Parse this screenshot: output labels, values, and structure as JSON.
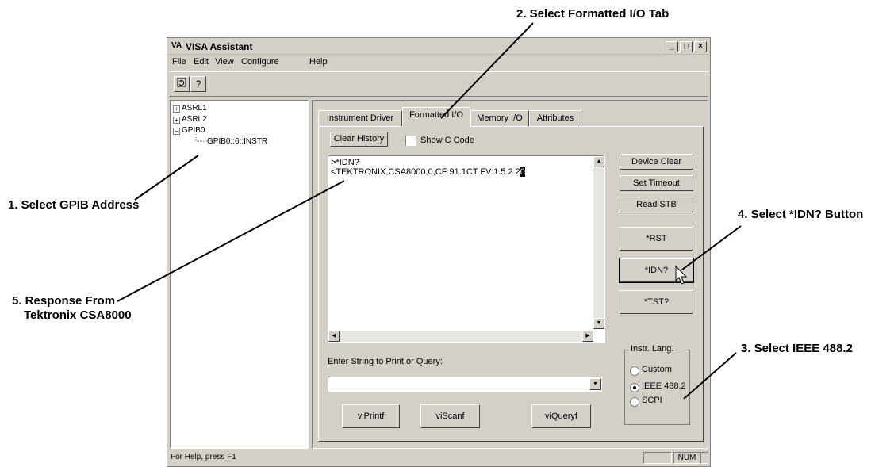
{
  "callouts": {
    "c1": "1. Select GPIB Address",
    "c2": "2. Select Formatted I/O Tab",
    "c3": "3. Select IEEE 488.2",
    "c4": "4. Select *IDN? Button",
    "c5_line1": "5. Response From",
    "c5_line2": "Tektronix CSA8000"
  },
  "window": {
    "title": "VISA Assistant",
    "icon_text": "VA",
    "minimize": "_",
    "maximize": "□",
    "close": "×"
  },
  "menu": [
    "File",
    "Edit",
    "View",
    "Configure",
    "Help"
  ],
  "toolbar": {
    "refresh_icon": "refresh-icon",
    "help_icon": "help-icon"
  },
  "tree": {
    "nodes": [
      {
        "label": "ASRL1",
        "expander": "+"
      },
      {
        "label": "ASRL2",
        "expander": "+"
      },
      {
        "label": "GPIB0",
        "expander": "−"
      },
      {
        "label": "GPIB0::6::INSTR",
        "expander": ""
      }
    ]
  },
  "tabs": [
    "Instrument Driver",
    "Formatted I/O",
    "Memory I/O",
    "Attributes"
  ],
  "formatted_io": {
    "clear_history": "Clear History",
    "show_c_code": "Show C Code",
    "output_lines": [
      ">*IDN?",
      "<TEKTRONIX,CSA8000,0,CF:91.1CT FV:1.5.2.2"
    ],
    "output_selected_char": "0",
    "side_buttons": [
      "Device Clear",
      "Set Timeout",
      "Read STB",
      "*RST",
      "*IDN?",
      "*TST?"
    ],
    "input_label": "Enter String to Print or Query:",
    "input_value": "",
    "action_buttons": [
      "viPrintf",
      "viScanf",
      "viQueryf"
    ],
    "lang_group": "Instr. Lang.",
    "lang_options": [
      "Custom",
      "IEEE 488.2",
      "SCPI"
    ],
    "lang_selected": "IEEE 488.2"
  },
  "status": {
    "help_text": "For Help, press F1",
    "num": "NUM"
  }
}
